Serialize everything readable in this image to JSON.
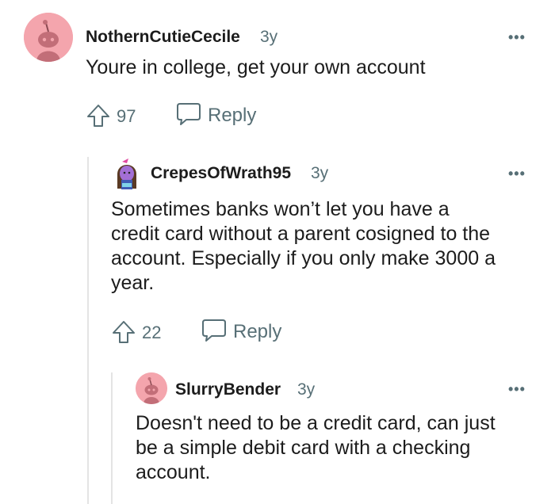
{
  "comments": [
    {
      "username": "NothernCutieCecile",
      "age": "3y",
      "text": "Youre in college, get your own account",
      "upvotes": "97",
      "reply_label": "Reply",
      "more_icon": "more-options-icon"
    },
    {
      "username": "CrepesOfWrath95",
      "age": "3y",
      "text_lines": [
        "Sometimes banks won’t let you have a",
        "credit card without a parent cosigned to the",
        "account. Especially if you only make 3000 a",
        "year."
      ],
      "upvotes": "22",
      "reply_label": "Reply",
      "more_icon": "more-options-icon"
    },
    {
      "username": "SlurryBender",
      "age": "3y",
      "text_lines": [
        "Doesn't need to be a credit card, can just",
        "be a simple debit card with a checking",
        "account."
      ],
      "more_icon": "more-options-icon"
    }
  ],
  "colors": {
    "avatar_bg": "#f4a5ad",
    "meta_gray": "#576f76",
    "thread_line": "#e4e4e4"
  }
}
